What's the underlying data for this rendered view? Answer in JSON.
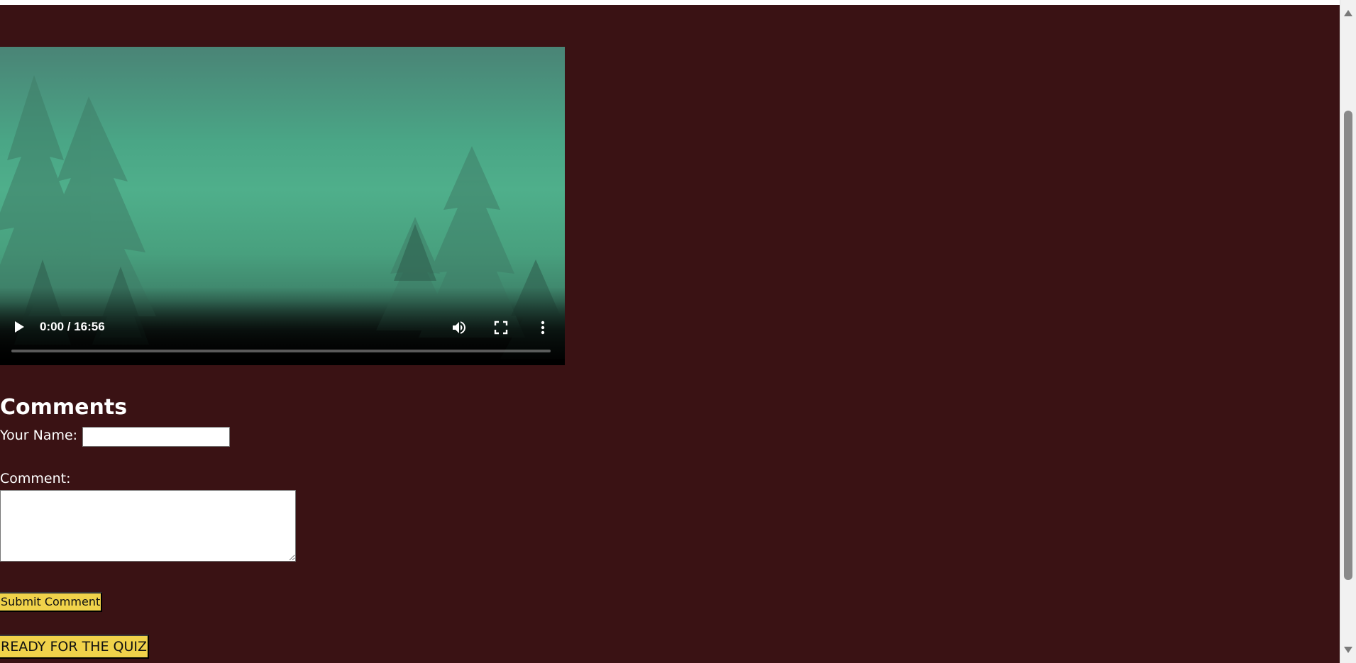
{
  "video": {
    "current_time": "0:00",
    "duration": "16:56",
    "time_display": "0:00 / 16:56",
    "progress_fraction": 0.0,
    "icons": {
      "play": "play-icon",
      "volume": "volume-icon",
      "fullscreen": "fullscreen-icon",
      "more": "more-options-icon"
    }
  },
  "comments": {
    "heading": "Comments",
    "name_label": "Your Name:",
    "name_value": "",
    "comment_label": "Comment:",
    "comment_value": "",
    "submit_label": "Submit Comment"
  },
  "quiz": {
    "button_label": "READY FOR THE QUIZ"
  },
  "colors": {
    "page_background": "#3a1214",
    "button_background": "#f0d24a",
    "text": "#ffffff"
  }
}
